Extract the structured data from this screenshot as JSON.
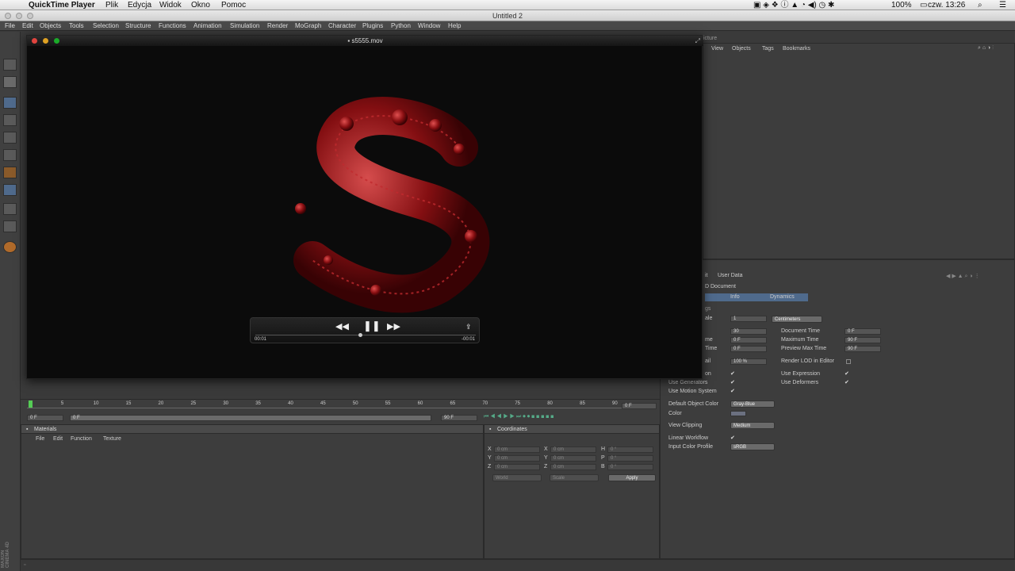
{
  "mac_menu": {
    "app": "QuickTime Player",
    "items": [
      "Plik",
      "Edycja",
      "Widok",
      "Okno",
      "Pomoc"
    ],
    "battery": "100%",
    "clock": "czw. 13:26"
  },
  "c4d": {
    "window_title": "Untitled 2",
    "menu": [
      "File",
      "Edit",
      "Objects",
      "Tools",
      "Selection",
      "Structure",
      "Functions",
      "Animation",
      "Simulation",
      "Render",
      "MoGraph",
      "Character",
      "Plugins",
      "Python",
      "Window",
      "Help"
    ],
    "brand": "MAXON CINEMA 4D"
  },
  "quicktime": {
    "title": "s5555.mov",
    "time_elapsed": "00:01",
    "time_remaining": "-00:01"
  },
  "object_manager": {
    "tab_fragment": "icture",
    "menu": [
      "View",
      "Objects",
      "Tags",
      "Bookmarks"
    ]
  },
  "timeline": {
    "ticks": [
      "0",
      "5",
      "10",
      "15",
      "20",
      "25",
      "30",
      "35",
      "40",
      "45",
      "50",
      "55",
      "60",
      "65",
      "70",
      "75",
      "80",
      "85",
      "90"
    ],
    "current_frame": "0 F",
    "start_frame": "0 F",
    "range_start": "0 F",
    "range_end": "90 F",
    "end_frame": "90 F"
  },
  "materials": {
    "title": "Materials",
    "menu": [
      "File",
      "Edit",
      "Function",
      "Texture"
    ]
  },
  "coordinates": {
    "title": "Coordinates",
    "rows": [
      {
        "axis": "X",
        "pos": "0 cm",
        "axis2": "X",
        "size": "0 cm",
        "rot_axis": "H",
        "rot": "0 °"
      },
      {
        "axis": "Y",
        "pos": "0 cm",
        "axis2": "Y",
        "size": "0 cm",
        "rot_axis": "P",
        "rot": "0 °"
      },
      {
        "axis": "Z",
        "pos": "0 cm",
        "axis2": "Z",
        "size": "0 cm",
        "rot_axis": "B",
        "rot": "0 °"
      }
    ],
    "mode1": "World",
    "mode2": "Scale",
    "apply": "Apply"
  },
  "attributes": {
    "menu_fragment": "it",
    "user_data": "User Data",
    "doc_fragment": "D Document",
    "tabs": [
      "Info",
      "Dynamics"
    ],
    "section_fragment": "gs",
    "scale_label_fragment": "ale",
    "scale_value": "1",
    "scale_unit": "Centimeters",
    "fps_value": "30",
    "doc_time_label": "Document Time",
    "doc_time_value": "0 F",
    "min_label_fragment": "me",
    "min_value": "0 F",
    "max_time_label": "Maximum Time",
    "max_time_value": "90 F",
    "prev_min_label_fragment": "Time",
    "prev_min_value": "0 F",
    "prev_max_label": "Preview Max Time",
    "prev_max_value": "90 F",
    "lod_label_fragment": "ail",
    "lod_value": "100 %",
    "render_lod_label": "Render LOD in Editor",
    "anim_label_fragment": "on",
    "use_expression": "Use Expression",
    "use_generators": "Use Generators",
    "use_deformers": "Use Deformers",
    "use_motion": "Use Motion System",
    "default_color_label": "Default Object Color",
    "default_color_value": "Gray-Blue",
    "color_label": "Color",
    "view_clipping_label": "View Clipping",
    "view_clipping_value": "Medium",
    "linear_workflow": "Linear Workflow",
    "input_profile_label": "Input Color Profile",
    "input_profile_value": "sRGB",
    "check": "✔"
  }
}
